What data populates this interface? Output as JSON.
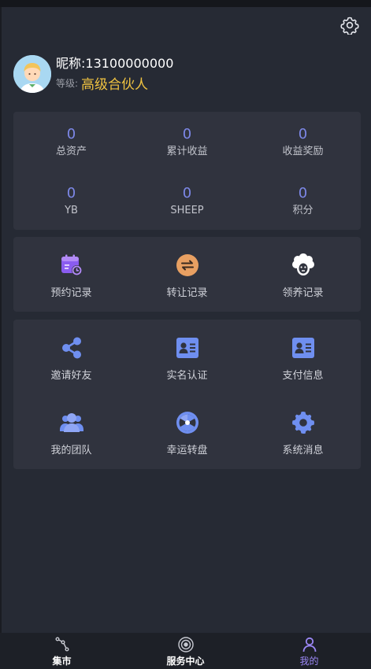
{
  "profile": {
    "nickname": "昵称:13100000000",
    "level_label": "等级:",
    "level_value": "高级合伙人",
    "avatar_icon": "user-avatar",
    "settings_icon": "gear-icon"
  },
  "stats": [
    {
      "value": "0",
      "label": "总资产"
    },
    {
      "value": "0",
      "label": "累计收益"
    },
    {
      "value": "0",
      "label": "收益奖励"
    },
    {
      "value": "0",
      "label": "YB"
    },
    {
      "value": "0",
      "label": "SHEEP"
    },
    {
      "value": "0",
      "label": "积分"
    }
  ],
  "records": [
    {
      "label": "预约记录",
      "icon": "calendar-clock-icon"
    },
    {
      "label": "转让记录",
      "icon": "transfer-icon"
    },
    {
      "label": "领养记录",
      "icon": "sheep-icon"
    }
  ],
  "tools": [
    {
      "label": "邀请好友",
      "icon": "share-icon"
    },
    {
      "label": "实名认证",
      "icon": "id-card-icon"
    },
    {
      "label": "支付信息",
      "icon": "id-card-icon"
    },
    {
      "label": "我的团队",
      "icon": "team-icon"
    },
    {
      "label": "幸运转盘",
      "icon": "wheel-icon"
    },
    {
      "label": "系统消息",
      "icon": "gear-icon"
    }
  ],
  "tabs": [
    {
      "label": "集市",
      "icon": "market-icon",
      "active": false
    },
    {
      "label": "服务中心",
      "icon": "service-icon",
      "active": false
    },
    {
      "label": "我的",
      "icon": "user-icon",
      "active": true
    }
  ],
  "colors": {
    "accent": "#7d88e8",
    "gold": "#f0c341",
    "active_tab": "#9b87f5",
    "background": "#262a34",
    "card": "#30333e"
  }
}
